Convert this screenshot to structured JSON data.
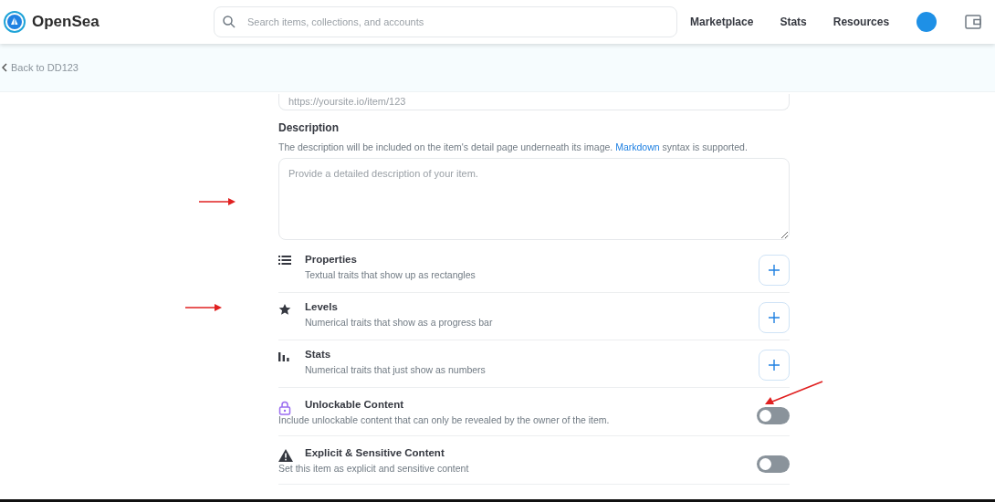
{
  "header": {
    "brand": "OpenSea",
    "search": {
      "placeholder": "Search items, collections, and accounts"
    },
    "nav": [
      "Marketplace",
      "Stats",
      "Resources"
    ]
  },
  "back_link": "Back to DD123",
  "url_field": {
    "placeholder": "https://yoursite.io/item/123"
  },
  "description": {
    "label": "Description",
    "help": "The description will be included on the item's detail page underneath its image. ",
    "help_link": "Markdown",
    "help_tail": " syntax is supported.",
    "placeholder": "Provide a detailed description of your item."
  },
  "sections": [
    {
      "kind": "add",
      "title": "Properties",
      "subtitle": "Textual traits that show up as rectangles"
    },
    {
      "kind": "add",
      "title": "Levels",
      "subtitle": "Numerical traits that show as a progress bar"
    },
    {
      "kind": "add",
      "title": "Stats",
      "subtitle": "Numerical traits that just show as numbers"
    },
    {
      "kind": "toggle",
      "title": "Unlockable Content",
      "subtitle": "Include unlockable content that can only be revealed by the owner of the item.",
      "on": false
    },
    {
      "kind": "toggle",
      "title": "Explicit & Sensitive Content",
      "subtitle": "Set this item as explicit and sensitive content",
      "on": false
    }
  ]
}
